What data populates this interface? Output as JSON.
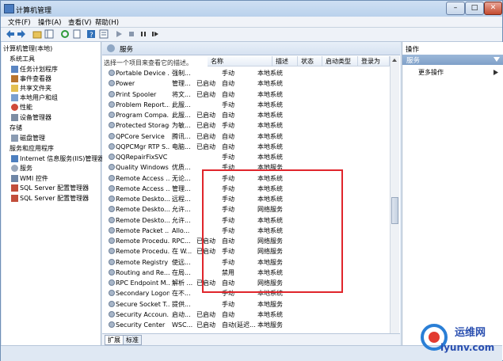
{
  "window": {
    "title": "计算机管理"
  },
  "menu": [
    "文件(F)",
    "操作(A)",
    "查看(V)",
    "帮助(H)"
  ],
  "tree": [
    "计算机管理(本地)",
    "系统工具",
    "任务计划程序",
    "事件查看器",
    "共享文件夹",
    "本地用户和组",
    "性能",
    "设备管理器",
    "存储",
    "磁盘管理",
    "服务和应用程序",
    "Internet 信息服务(IIS)管理器",
    "服务",
    "WMI 控件",
    "SQL Server 配置管理器",
    "SQL Server 配置管理器"
  ],
  "services_panel": {
    "header": "服务",
    "description": "选择一个项目来查看它的描述。"
  },
  "columns": [
    "名称",
    "描述",
    "状态",
    "启动类型",
    "登录为"
  ],
  "rows": [
    {
      "name": "Portable Device ...",
      "desc": "强制...",
      "status": "",
      "startup": "手动",
      "logon": "本地系统"
    },
    {
      "name": "Power",
      "desc": "管理...",
      "status": "已启动",
      "startup": "自动",
      "logon": "本地系统"
    },
    {
      "name": "Print Spooler",
      "desc": "将文...",
      "status": "已启动",
      "startup": "自动",
      "logon": "本地系统"
    },
    {
      "name": "Problem Report...",
      "desc": "此服...",
      "status": "",
      "startup": "手动",
      "logon": "本地系统"
    },
    {
      "name": "Program Compa...",
      "desc": "此服...",
      "status": "已启动",
      "startup": "自动",
      "logon": "本地系统"
    },
    {
      "name": "Protected Storage",
      "desc": "为敏...",
      "status": "已启动",
      "startup": "手动",
      "logon": "本地系统"
    },
    {
      "name": "QPCore Service",
      "desc": "腾讯...",
      "status": "已启动",
      "startup": "自动",
      "logon": "本地系统"
    },
    {
      "name": "QQPCMgr RTP S...",
      "desc": "电脑...",
      "status": "已启动",
      "startup": "自动",
      "logon": "本地系统"
    },
    {
      "name": "QQRepairFixSVC",
      "desc": "",
      "status": "",
      "startup": "手动",
      "logon": "本地系统"
    },
    {
      "name": "Quality Windows ...",
      "desc": "优质...",
      "status": "",
      "startup": "手动",
      "logon": "本地服务"
    },
    {
      "name": "Remote Access ...",
      "desc": "无论...",
      "status": "",
      "startup": "手动",
      "logon": "本地系统"
    },
    {
      "name": "Remote Access ...",
      "desc": "管理...",
      "status": "",
      "startup": "手动",
      "logon": "本地系统"
    },
    {
      "name": "Remote Deskto...",
      "desc": "远程...",
      "status": "",
      "startup": "手动",
      "logon": "本地系统"
    },
    {
      "name": "Remote Deskto...",
      "desc": "允许...",
      "status": "",
      "startup": "手动",
      "logon": "网络服务"
    },
    {
      "name": "Remote Deskto...",
      "desc": "允许...",
      "status": "",
      "startup": "手动",
      "logon": "本地系统"
    },
    {
      "name": "Remote Packet ...",
      "desc": "Allo...",
      "status": "",
      "startup": "手动",
      "logon": "本地系统"
    },
    {
      "name": "Remote Procedu...",
      "desc": "RPC...",
      "status": "已启动",
      "startup": "自动",
      "logon": "网络服务"
    },
    {
      "name": "Remote Procedu...",
      "desc": "在 W...",
      "status": "已启动",
      "startup": "手动",
      "logon": "网络服务"
    },
    {
      "name": "Remote Registry",
      "desc": "使远...",
      "status": "",
      "startup": "手动",
      "logon": "本地服务"
    },
    {
      "name": "Routing and Re...",
      "desc": "在局...",
      "status": "",
      "startup": "禁用",
      "logon": "本地系统"
    },
    {
      "name": "RPC Endpoint M...",
      "desc": "解析 ...",
      "status": "已启动",
      "startup": "自动",
      "logon": "网络服务"
    },
    {
      "name": "Secondary Logon",
      "desc": "在不...",
      "status": "",
      "startup": "手动",
      "logon": "本地系统"
    },
    {
      "name": "Secure Socket T...",
      "desc": "提供...",
      "status": "",
      "startup": "手动",
      "logon": "本地服务"
    },
    {
      "name": "Security Accoun...",
      "desc": "启动...",
      "status": "已启动",
      "startup": "自动",
      "logon": "本地系统"
    },
    {
      "name": "Security Center",
      "desc": "WSC...",
      "status": "已启动",
      "startup": "自动(延迟...",
      "logon": "本地服务"
    }
  ],
  "tabs": [
    "扩展",
    "标准"
  ],
  "actions": {
    "title": "操作",
    "section": "服务",
    "more": "更多操作"
  },
  "watermark": {
    "text": "运维网",
    "url": "iyunv.com"
  }
}
